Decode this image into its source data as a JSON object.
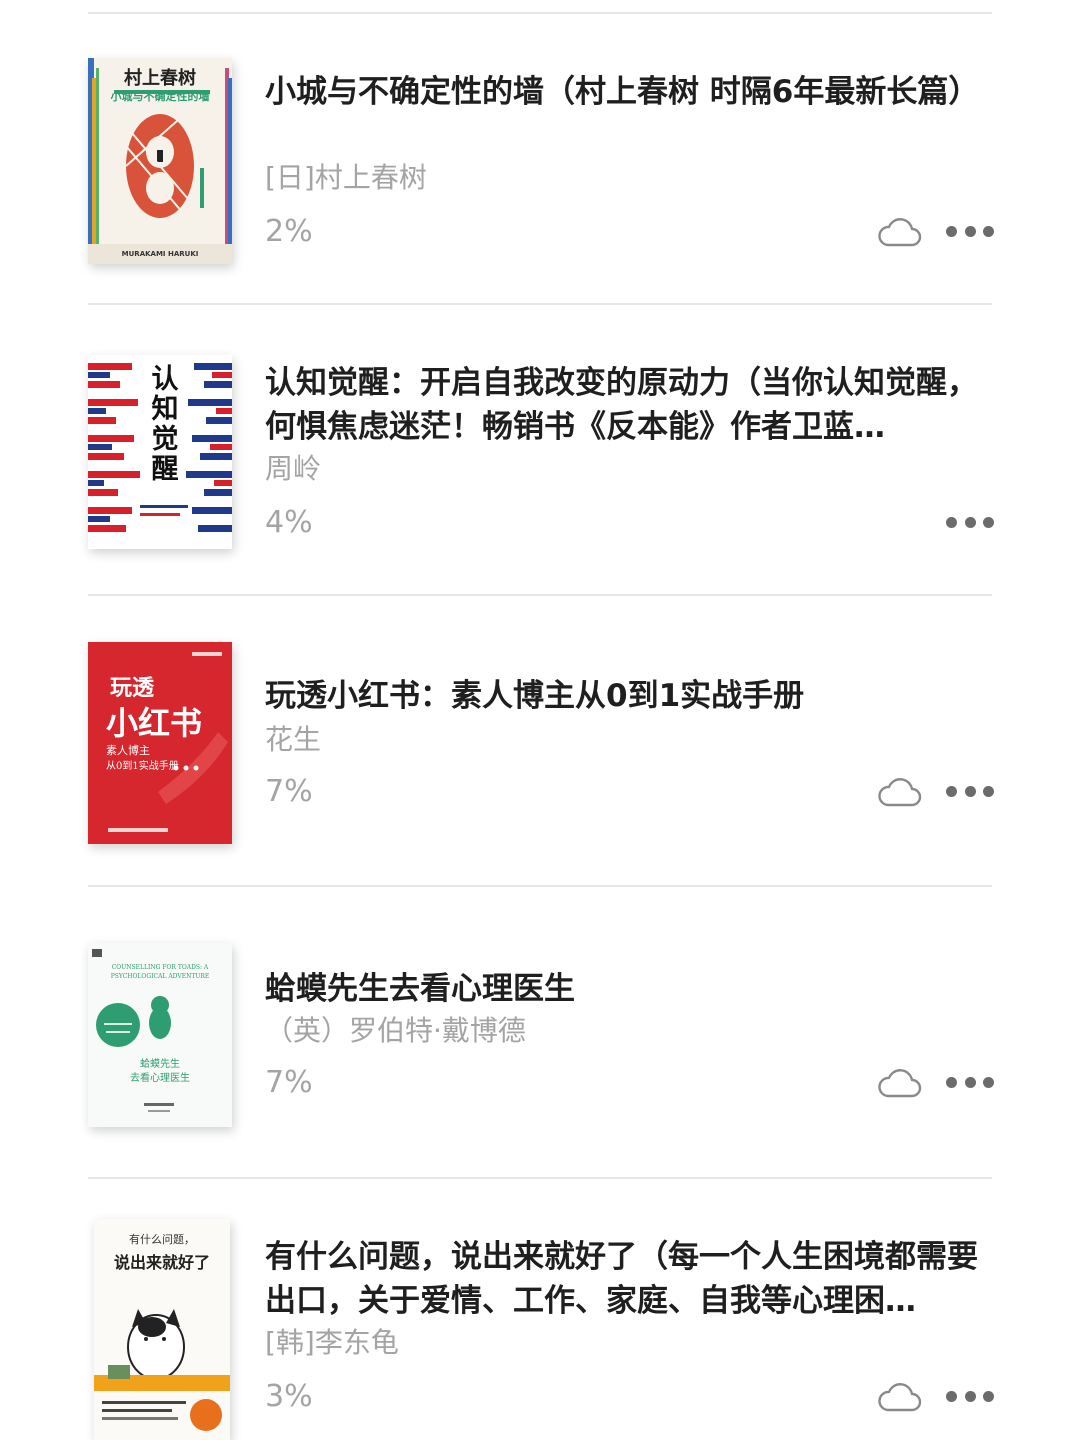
{
  "books": [
    {
      "title": "小城与不确定性的墙（村上春树 时隔6年最新长篇）",
      "author": "[日]村上春树",
      "progress": "2%",
      "cloud_icon": "cloud-icon",
      "cover": {
        "title_text": "村上春树",
        "subtitle_text": "小城与不确定性的墙",
        "author_en": "MURAKAMI HARUKI",
        "bg": "#f6f2ea",
        "accent": "#d9533a"
      }
    },
    {
      "title": "认知觉醒：开启自我改变的原动力（当你认知觉醒，何惧焦虑迷茫！畅销书《反本能》作者卫蓝…",
      "author": "周岭",
      "progress": "4%",
      "cloud_icon": "",
      "cover": {
        "title_text": "认知觉醒",
        "bg": "#ffffff",
        "accent": "#d8202a",
        "accent2": "#1f3a8a"
      }
    },
    {
      "title": "玩透小红书：素人博主从0到1实战手册",
      "author": "花生",
      "progress": "7%",
      "cloud_icon": "cloud-icon",
      "cover": {
        "title_text": "玩透",
        "title_text2": "小红书",
        "subtitle_text": "素人博主",
        "subtitle_text2": "从0到1实战手册",
        "bg": "#d6262e"
      }
    },
    {
      "title": "蛤蟆先生去看心理医生",
      "author": "（英）罗伯特·戴博德",
      "progress": "7%",
      "cloud_icon": "cloud-icon",
      "cover": {
        "en_title": "COUNSELLING FOR TOADS: A PSYCHOLOGICAL ADVENTURE",
        "title_text": "蛤蟆先生",
        "subtitle_text": "去看心理医生",
        "bg": "#f7faf8",
        "accent": "#2f9d72"
      }
    },
    {
      "title": "有什么问题，说出来就好了（每一个人生困境都需要出口，关于爱情、工作、家庭、自我等心理困…",
      "author": "[韩]李东龟",
      "progress": "3%",
      "cloud_icon": "cloud-icon",
      "cover": {
        "title_text": "有什么问题，",
        "title_text2": "说出来就好了",
        "bg": "#fbfaf6",
        "accent": "#f0a21a"
      }
    }
  ]
}
